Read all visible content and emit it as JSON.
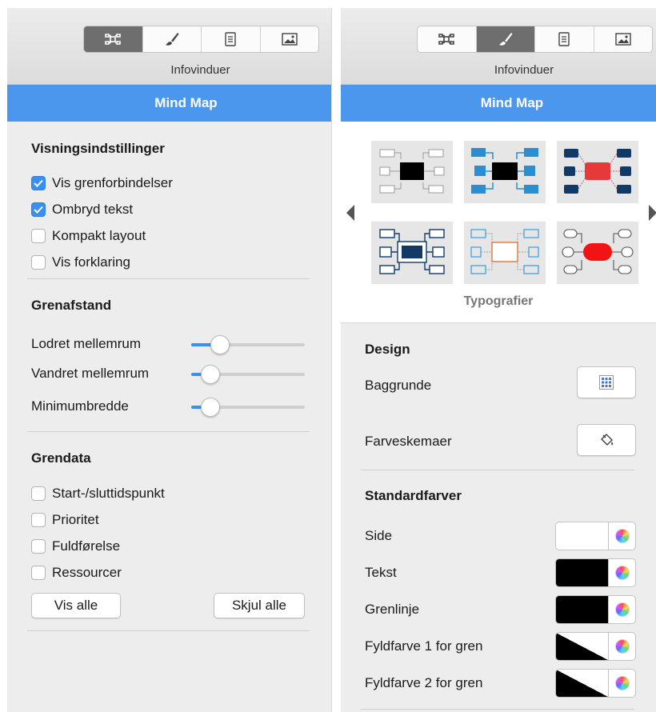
{
  "left": {
    "toolbar": {
      "title": "Infovinduer",
      "active_tab": "map-structure"
    },
    "tab_title": "Mind Map",
    "view_settings": {
      "heading": "Visningsindstillinger",
      "options": [
        {
          "label": "Vis grenforbindelser",
          "checked": true
        },
        {
          "label": "Ombryd tekst",
          "checked": true
        },
        {
          "label": "Kompakt layout",
          "checked": false
        },
        {
          "label": "Vis forklaring",
          "checked": false
        }
      ]
    },
    "branch_spacing": {
      "heading": "Grenafstand",
      "sliders": [
        {
          "label": "Lodret mellemrum",
          "value": 0.25
        },
        {
          "label": "Vandret mellemrum",
          "value": 0.17
        },
        {
          "label": "Minimumbredde",
          "value": 0.17
        }
      ]
    },
    "branch_data": {
      "heading": "Grendata",
      "options": [
        {
          "label": "Start-/sluttidspunkt",
          "checked": false
        },
        {
          "label": "Prioritet",
          "checked": false
        },
        {
          "label": "Fuldførelse",
          "checked": false
        },
        {
          "label": "Ressourcer",
          "checked": false
        }
      ],
      "show_all": "Vis alle",
      "hide_all": "Skjul alle"
    }
  },
  "right": {
    "toolbar": {
      "title": "Infovinduer",
      "active_tab": "style"
    },
    "tab_title": "Mind Map",
    "styles_label": "Typografier",
    "design": {
      "heading": "Design",
      "backgrounds_label": "Baggrunde",
      "color_schemes_label": "Farveskemaer"
    },
    "standard_colors": {
      "heading": "Standardfarver",
      "rows": [
        {
          "label": "Side",
          "type": "solid",
          "color": "#ffffff"
        },
        {
          "label": "Tekst",
          "type": "solid",
          "color": "#000000"
        },
        {
          "label": "Grenlinje",
          "type": "solid",
          "color": "#000000"
        },
        {
          "label": "Fyldfarve 1 for gren",
          "type": "split",
          "color": "#000000"
        },
        {
          "label": "Fyldfarve 2 for gren",
          "type": "split",
          "color": "#000000"
        }
      ]
    }
  },
  "colors": {
    "accent": "#4a97ed",
    "checkbox": "#3a8ff0",
    "style_red": "#e63a3a",
    "style_blue": "#2a8fd0",
    "style_navy": "#123a66"
  }
}
